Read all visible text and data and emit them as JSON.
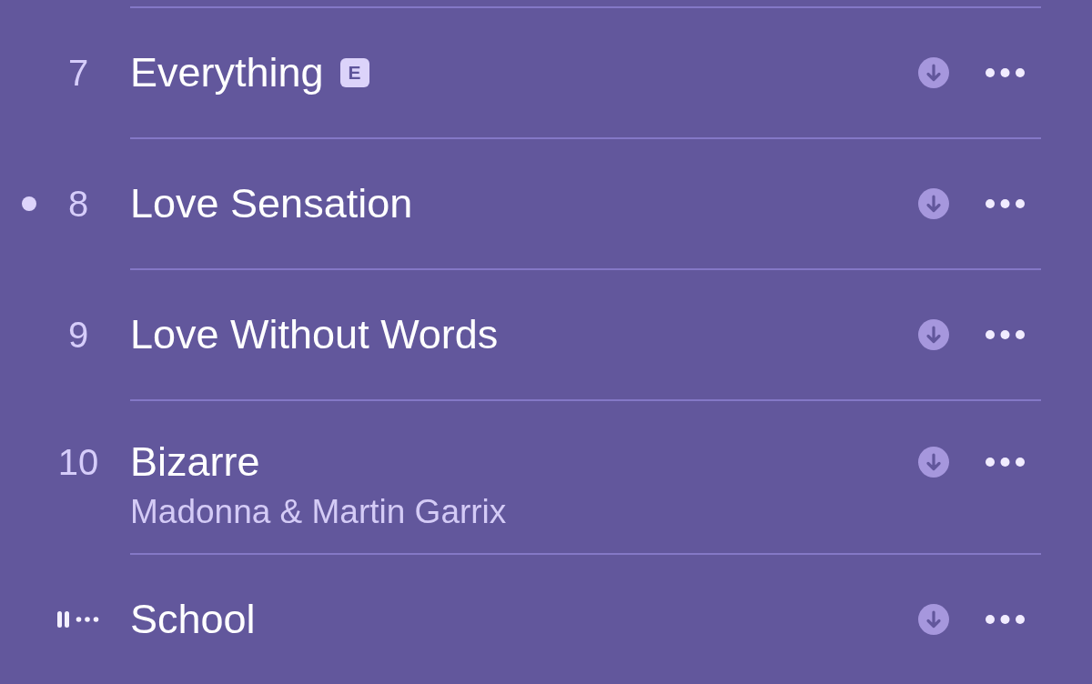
{
  "tracks": [
    {
      "number": "7",
      "title": "Everything",
      "badge": "E",
      "dot_marker": false,
      "playing": false
    },
    {
      "number": "8",
      "title": "Love Sensation",
      "dot_marker": true,
      "playing": false
    },
    {
      "number": "9",
      "title": "Love Without Words",
      "dot_marker": false,
      "playing": false
    },
    {
      "number": "10",
      "title": "Bizarre",
      "artist": "Madonna & Martin Garrix",
      "dot_marker": false,
      "playing": false
    },
    {
      "title": "School",
      "dot_marker": false,
      "playing": true
    }
  ]
}
